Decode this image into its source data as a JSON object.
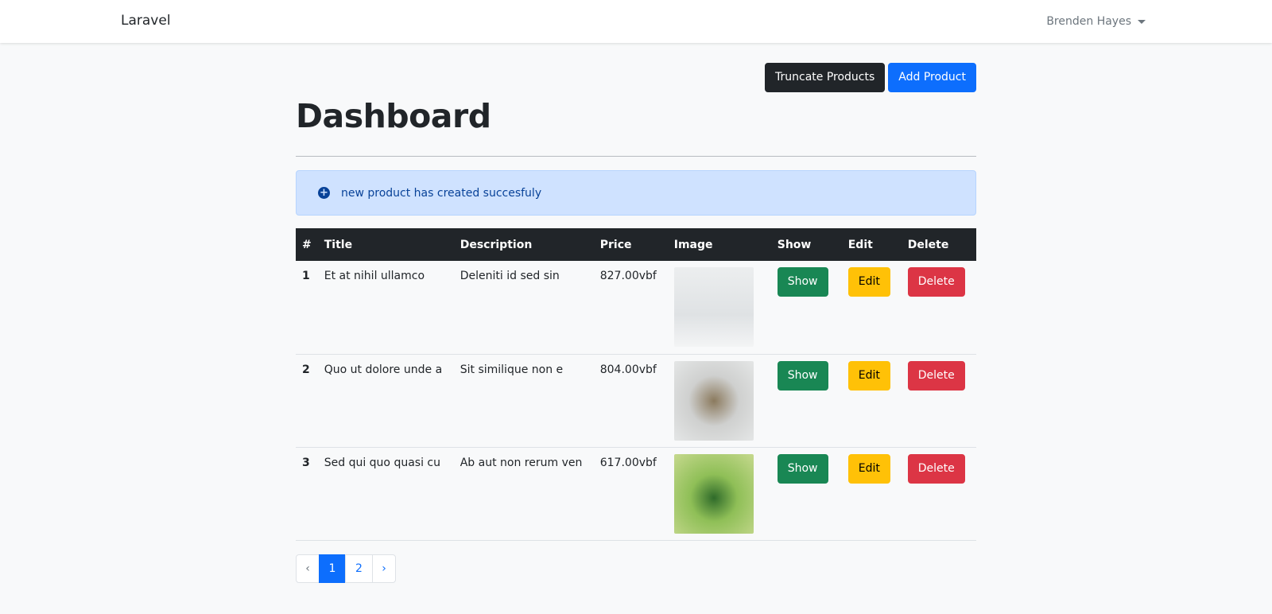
{
  "navbar": {
    "brand": "Laravel",
    "user_name": "Brenden Hayes"
  },
  "actions": {
    "truncate_label": "Truncate Products",
    "add_label": "Add Product"
  },
  "page": {
    "title": "Dashboard"
  },
  "alert": {
    "icon": "plus-circle-icon",
    "message": "new product has created succesfuly"
  },
  "table": {
    "headers": [
      "#",
      "Title",
      "Description",
      "Price",
      "Image",
      "Show",
      "Edit",
      "Delete"
    ],
    "rows": [
      {
        "num": "1",
        "title": "Et at nihil ullamco",
        "description": "Deleniti id sed sin",
        "price": "827.00vbf",
        "show": "Show",
        "edit": "Edit",
        "delete": "Delete"
      },
      {
        "num": "2",
        "title": "Quo ut dolore unde a",
        "description": "Sit similique non e",
        "price": "804.00vbf",
        "show": "Show",
        "edit": "Edit",
        "delete": "Delete"
      },
      {
        "num": "3",
        "title": "Sed qui quo quasi cu",
        "description": "Ab aut non rerum ven",
        "price": "617.00vbf",
        "show": "Show",
        "edit": "Edit",
        "delete": "Delete"
      }
    ]
  },
  "pagination": {
    "prev": "‹",
    "pages": [
      "1",
      "2"
    ],
    "next": "›",
    "current": 1
  },
  "colors": {
    "primary": "#0d6efd",
    "dark": "#212529",
    "success": "#198754",
    "warning": "#ffc107",
    "danger": "#dc3545",
    "alert_bg": "#cfe2ff"
  }
}
